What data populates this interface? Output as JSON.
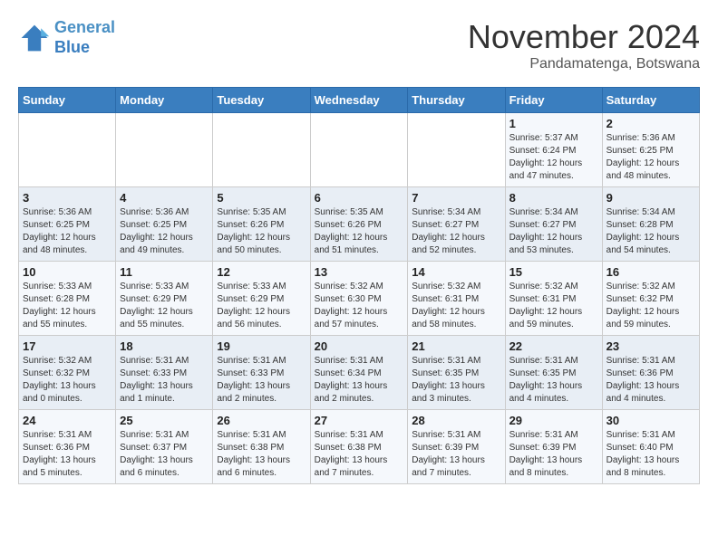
{
  "header": {
    "logo_line1": "General",
    "logo_line2": "Blue",
    "month": "November 2024",
    "location": "Pandamatenga, Botswana"
  },
  "weekdays": [
    "Sunday",
    "Monday",
    "Tuesday",
    "Wednesday",
    "Thursday",
    "Friday",
    "Saturday"
  ],
  "weeks": [
    [
      {
        "day": "",
        "info": ""
      },
      {
        "day": "",
        "info": ""
      },
      {
        "day": "",
        "info": ""
      },
      {
        "day": "",
        "info": ""
      },
      {
        "day": "",
        "info": ""
      },
      {
        "day": "1",
        "info": "Sunrise: 5:37 AM\nSunset: 6:24 PM\nDaylight: 12 hours\nand 47 minutes."
      },
      {
        "day": "2",
        "info": "Sunrise: 5:36 AM\nSunset: 6:25 PM\nDaylight: 12 hours\nand 48 minutes."
      }
    ],
    [
      {
        "day": "3",
        "info": "Sunrise: 5:36 AM\nSunset: 6:25 PM\nDaylight: 12 hours\nand 48 minutes."
      },
      {
        "day": "4",
        "info": "Sunrise: 5:36 AM\nSunset: 6:25 PM\nDaylight: 12 hours\nand 49 minutes."
      },
      {
        "day": "5",
        "info": "Sunrise: 5:35 AM\nSunset: 6:26 PM\nDaylight: 12 hours\nand 50 minutes."
      },
      {
        "day": "6",
        "info": "Sunrise: 5:35 AM\nSunset: 6:26 PM\nDaylight: 12 hours\nand 51 minutes."
      },
      {
        "day": "7",
        "info": "Sunrise: 5:34 AM\nSunset: 6:27 PM\nDaylight: 12 hours\nand 52 minutes."
      },
      {
        "day": "8",
        "info": "Sunrise: 5:34 AM\nSunset: 6:27 PM\nDaylight: 12 hours\nand 53 minutes."
      },
      {
        "day": "9",
        "info": "Sunrise: 5:34 AM\nSunset: 6:28 PM\nDaylight: 12 hours\nand 54 minutes."
      }
    ],
    [
      {
        "day": "10",
        "info": "Sunrise: 5:33 AM\nSunset: 6:28 PM\nDaylight: 12 hours\nand 55 minutes."
      },
      {
        "day": "11",
        "info": "Sunrise: 5:33 AM\nSunset: 6:29 PM\nDaylight: 12 hours\nand 55 minutes."
      },
      {
        "day": "12",
        "info": "Sunrise: 5:33 AM\nSunset: 6:29 PM\nDaylight: 12 hours\nand 56 minutes."
      },
      {
        "day": "13",
        "info": "Sunrise: 5:32 AM\nSunset: 6:30 PM\nDaylight: 12 hours\nand 57 minutes."
      },
      {
        "day": "14",
        "info": "Sunrise: 5:32 AM\nSunset: 6:31 PM\nDaylight: 12 hours\nand 58 minutes."
      },
      {
        "day": "15",
        "info": "Sunrise: 5:32 AM\nSunset: 6:31 PM\nDaylight: 12 hours\nand 59 minutes."
      },
      {
        "day": "16",
        "info": "Sunrise: 5:32 AM\nSunset: 6:32 PM\nDaylight: 12 hours\nand 59 minutes."
      }
    ],
    [
      {
        "day": "17",
        "info": "Sunrise: 5:32 AM\nSunset: 6:32 PM\nDaylight: 13 hours\nand 0 minutes."
      },
      {
        "day": "18",
        "info": "Sunrise: 5:31 AM\nSunset: 6:33 PM\nDaylight: 13 hours\nand 1 minute."
      },
      {
        "day": "19",
        "info": "Sunrise: 5:31 AM\nSunset: 6:33 PM\nDaylight: 13 hours\nand 2 minutes."
      },
      {
        "day": "20",
        "info": "Sunrise: 5:31 AM\nSunset: 6:34 PM\nDaylight: 13 hours\nand 2 minutes."
      },
      {
        "day": "21",
        "info": "Sunrise: 5:31 AM\nSunset: 6:35 PM\nDaylight: 13 hours\nand 3 minutes."
      },
      {
        "day": "22",
        "info": "Sunrise: 5:31 AM\nSunset: 6:35 PM\nDaylight: 13 hours\nand 4 minutes."
      },
      {
        "day": "23",
        "info": "Sunrise: 5:31 AM\nSunset: 6:36 PM\nDaylight: 13 hours\nand 4 minutes."
      }
    ],
    [
      {
        "day": "24",
        "info": "Sunrise: 5:31 AM\nSunset: 6:36 PM\nDaylight: 13 hours\nand 5 minutes."
      },
      {
        "day": "25",
        "info": "Sunrise: 5:31 AM\nSunset: 6:37 PM\nDaylight: 13 hours\nand 6 minutes."
      },
      {
        "day": "26",
        "info": "Sunrise: 5:31 AM\nSunset: 6:38 PM\nDaylight: 13 hours\nand 6 minutes."
      },
      {
        "day": "27",
        "info": "Sunrise: 5:31 AM\nSunset: 6:38 PM\nDaylight: 13 hours\nand 7 minutes."
      },
      {
        "day": "28",
        "info": "Sunrise: 5:31 AM\nSunset: 6:39 PM\nDaylight: 13 hours\nand 7 minutes."
      },
      {
        "day": "29",
        "info": "Sunrise: 5:31 AM\nSunset: 6:39 PM\nDaylight: 13 hours\nand 8 minutes."
      },
      {
        "day": "30",
        "info": "Sunrise: 5:31 AM\nSunset: 6:40 PM\nDaylight: 13 hours\nand 8 minutes."
      }
    ]
  ]
}
